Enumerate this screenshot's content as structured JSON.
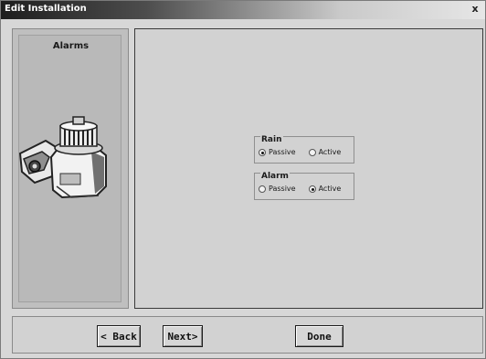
{
  "window": {
    "title": "Edit Installation",
    "close_glyph": "x"
  },
  "sidebar": {
    "title": "Alarms",
    "image_icon": "alarm-siren-device"
  },
  "rain": {
    "label": "Rain",
    "options": [
      "Passive",
      "Active"
    ],
    "selected": "Passive"
  },
  "alarm": {
    "label": "Alarm",
    "options": [
      "Passive",
      "Active"
    ],
    "selected": "Active"
  },
  "buttons": {
    "back": "< Back",
    "next": "Next>",
    "done": "Done"
  }
}
